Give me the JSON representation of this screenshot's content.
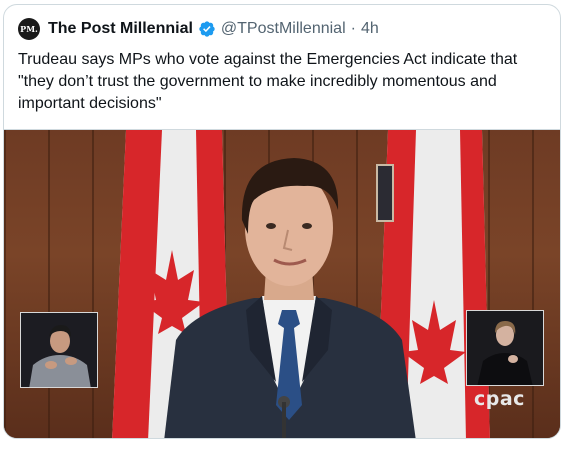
{
  "tweet": {
    "avatar_text": "PM.",
    "display_name": "The Post Millennial",
    "handle": "@TPostMillennial",
    "separator": "·",
    "timestamp": "4h",
    "text": "Trudeau says MPs who vote against the Emergencies Act indicate that \"they don’t trust the government to make incredibly momentous and important decisions\""
  },
  "media": {
    "type": "video-still",
    "watermark": "cpac",
    "accent_colors": {
      "flag_red": "#d7262a",
      "wall": "#6e3b24",
      "suit": "#28303f",
      "tie": "#2b4f86"
    }
  },
  "icons": {
    "verified": "verified-badge-icon"
  },
  "colors": {
    "verified_blue": "#1d9bf0",
    "secondary_text": "#536471",
    "border": "#cfd9de"
  }
}
